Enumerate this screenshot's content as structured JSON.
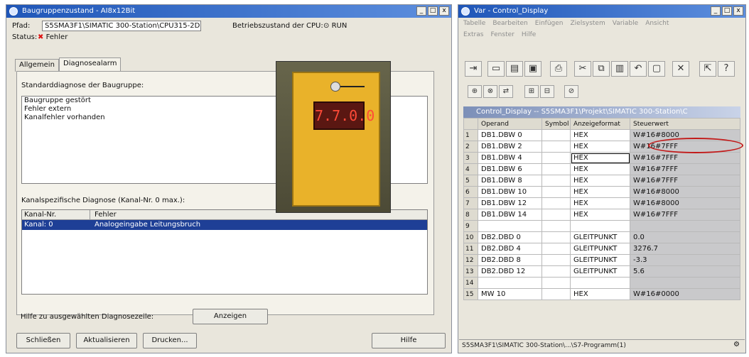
{
  "window1": {
    "title": "Baugruppenzustand - AI8x12Bit",
    "pfad_label": "Pfad:",
    "pfad_value": "S5SMA3F1\\SIMATIC 300-Station\\CPU315-2DP",
    "betriebszustand_label": "Betriebszustand der CPU:",
    "betriebszustand_value": "RUN",
    "status_label": "Status:",
    "status_value": "Fehler",
    "tabs": [
      "Allgemein",
      "Diagnosealarm"
    ],
    "standard_label": "Standarddiagnose der Baugruppe:",
    "standard_items": [
      "Baugruppe gestört",
      "Fehler extern",
      "Kanalfehler vorhanden"
    ],
    "channel_label": "Kanalspezifische Diagnose (Kanal-Nr. 0 max.):",
    "channel_headers": [
      "Kanal-Nr.",
      "Fehler"
    ],
    "channel_rows": [
      {
        "kanal": "Kanal: 0",
        "fehler": "Analogeingabe Leitungsbruch"
      }
    ],
    "hilfe_label": "Hilfe zu ausgewählten Diagnosezeile:",
    "anzeigen_button": "Anzeigen",
    "buttons": [
      "Schließen",
      "Aktualisieren",
      "Drucken...",
      "Hilfe"
    ],
    "display_reading": "7.7.0.0"
  },
  "window2": {
    "title": "Var - Control_Display",
    "menu_row1": [
      "Tabelle",
      "Bearbeiten",
      "Einfügen",
      "Zielsystem",
      "Variable",
      "Ansicht"
    ],
    "menu_row2": [
      "Extras",
      "Fenster",
      "Hilfe"
    ],
    "inner_title": "Control_Display  -- S5SMA3F1\\Projekt\\SIMATIC 300-Station\\C",
    "headers": [
      "Operand",
      "Symbol",
      "Anzeigeformat",
      "Steuerwert"
    ],
    "rows": [
      {
        "n": "1",
        "operand": "DB1.DBW   0",
        "format": "HEX",
        "value": "W#16#8000"
      },
      {
        "n": "2",
        "operand": "DB1.DBW   2",
        "format": "HEX",
        "value": "W#16#7FFF"
      },
      {
        "n": "3",
        "operand": "DB1.DBW   4",
        "format": "HEX",
        "value": "W#16#7FFF"
      },
      {
        "n": "4",
        "operand": "DB1.DBW   6",
        "format": "HEX",
        "value": "W#16#7FFF"
      },
      {
        "n": "5",
        "operand": "DB1.DBW   8",
        "format": "HEX",
        "value": "W#16#7FFF"
      },
      {
        "n": "6",
        "operand": "DB1.DBW  10",
        "format": "HEX",
        "value": "W#16#8000"
      },
      {
        "n": "7",
        "operand": "DB1.DBW  12",
        "format": "HEX",
        "value": "W#16#8000"
      },
      {
        "n": "8",
        "operand": "DB1.DBW  14",
        "format": "HEX",
        "value": "W#16#7FFF"
      },
      {
        "n": "9",
        "operand": "",
        "format": "",
        "value": ""
      },
      {
        "n": "10",
        "operand": "DB2.DBD   0",
        "format": "GLEITPUNKT",
        "value": "0.0"
      },
      {
        "n": "11",
        "operand": "DB2.DBD   4",
        "format": "GLEITPUNKT",
        "value": "3276.7"
      },
      {
        "n": "12",
        "operand": "DB2.DBD   8",
        "format": "GLEITPUNKT",
        "value": "-3.3"
      },
      {
        "n": "13",
        "operand": "DB2.DBD  12",
        "format": "GLEITPUNKT",
        "value": "5.6"
      },
      {
        "n": "14",
        "operand": "",
        "format": "",
        "value": ""
      },
      {
        "n": "15",
        "operand": "MW   10",
        "format": "HEX",
        "value": "W#16#0000"
      }
    ],
    "status": "S5SMA3F1\\SIMATIC 300-Station\\...\\S7-Programm(1)"
  }
}
